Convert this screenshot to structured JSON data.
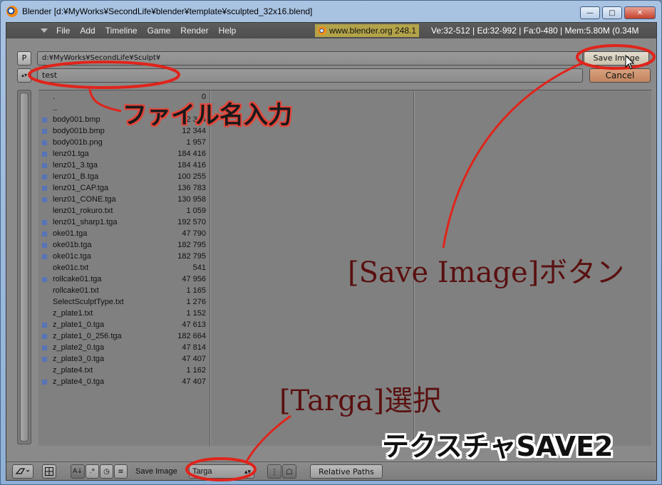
{
  "window": {
    "title": "Blender [d:¥MyWorks¥SecondLife¥blender¥template¥sculpted_32x16.blend]",
    "minimize": "—",
    "maximize": "□",
    "close": "✕"
  },
  "menubar": {
    "items": [
      "File",
      "Add",
      "Timeline",
      "Game",
      "Render",
      "Help"
    ],
    "site": "www.blender.org 248.1",
    "stats": "Ve:32-512 | Ed:32-992 | Fa:0-480 | Mem:5.80M (0.34M"
  },
  "browser": {
    "p_button": "P",
    "directory": "d:¥MyWorks¥SecondLife¥Sculpt¥",
    "save_label": "Save Image",
    "stepper": "▴▾",
    "filename": "test",
    "cancel_label": "Cancel",
    "files": [
      {
        "name": ".",
        "size": "0",
        "mark": false
      },
      {
        "name": "..",
        "size": "0",
        "mark": false
      },
      {
        "name": "body001.bmp",
        "size": "12 344",
        "mark": true
      },
      {
        "name": "body001b.bmp",
        "size": "12 344",
        "mark": true
      },
      {
        "name": "body001b.png",
        "size": "1 957",
        "mark": true
      },
      {
        "name": "lenz01.tga",
        "size": "184 416",
        "mark": true
      },
      {
        "name": "lenz01_3.tga",
        "size": "184 416",
        "mark": true
      },
      {
        "name": "lenz01_B.tga",
        "size": "100 255",
        "mark": true
      },
      {
        "name": "lenz01_CAP.tga",
        "size": "136 783",
        "mark": true
      },
      {
        "name": "lenz01_CONE.tga",
        "size": "130 958",
        "mark": true
      },
      {
        "name": "lenz01_rokuro.txt",
        "size": "1 059",
        "mark": false
      },
      {
        "name": "lenz01_sharp1.tga",
        "size": "192 570",
        "mark": true
      },
      {
        "name": "oke01.tga",
        "size": "47 790",
        "mark": true
      },
      {
        "name": "oke01b.tga",
        "size": "182 795",
        "mark": true
      },
      {
        "name": "oke01c.tga",
        "size": "182 795",
        "mark": true
      },
      {
        "name": "oke01c.txt",
        "size": "541",
        "mark": false
      },
      {
        "name": "rollcake01.tga",
        "size": "47 956",
        "mark": true
      },
      {
        "name": "rollcake01.txt",
        "size": "1 165",
        "mark": false
      },
      {
        "name": "SelectSculptType.txt",
        "size": "1 276",
        "mark": false
      },
      {
        "name": "z_plate1.txt",
        "size": "1 152",
        "mark": false
      },
      {
        "name": "z_plate1_0.tga",
        "size": "47 613",
        "mark": true
      },
      {
        "name": "z_plate1_0_256.tga",
        "size": "182 664",
        "mark": true
      },
      {
        "name": "z_plate2_0.tga",
        "size": "47 814",
        "mark": true
      },
      {
        "name": "z_plate3_0.tga",
        "size": "47 407",
        "mark": true
      },
      {
        "name": "z_plate4.txt",
        "size": "1 162",
        "mark": false
      },
      {
        "name": "z_plate4_0.tga",
        "size": "47 407",
        "mark": true
      }
    ]
  },
  "bottom": {
    "save_image_label": "Save Image",
    "format": "Targa",
    "relative_paths": "Relative Paths"
  },
  "annotations": {
    "filename_note": "ファイル名入力",
    "save_note": "[Save Image]ボタン",
    "targa_note": "[Targa]選択",
    "big_title": "テクスチャSAVE2",
    "red": "#e0241b"
  }
}
